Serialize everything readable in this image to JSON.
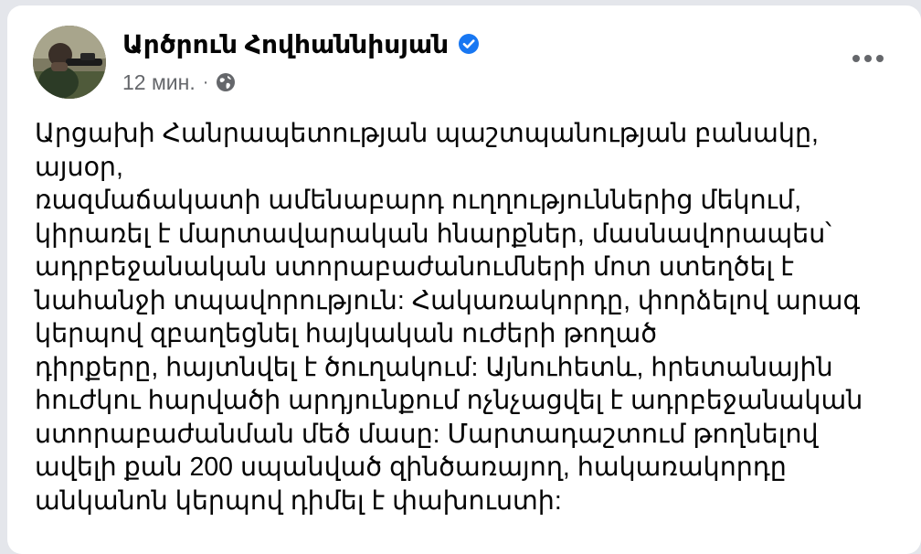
{
  "post": {
    "author": {
      "name": "Արծրուն Հովհաննիսյան",
      "verified_icon": "verified-badge-icon",
      "avatar": "profile-photo"
    },
    "meta": {
      "time": "12 мин.",
      "separator": "·",
      "audience_icon": "globe-icon"
    },
    "more_icon": "more-options-icon",
    "text_lines": [
      "Արցախի Հանրապետության պաշտպանության բանակը,",
      "այսօր,",
      "ռազմաճակատի ամենաբարդ ուղղություններից մեկում,",
      "կիրառել է մարտավարական հնարքներ, մասնավորապես՝",
      "ադրբեջանական ստորաբաժանումների մոտ ստեղծել է",
      "նահանջի տպավորություն: Հակառակորդը, փորձելով արագ",
      "կերպով զբաղեցնել հայկական ուժերի թողած",
      "դիրքերը, հայտնվել է ծուղակում: Այնուհետև, հրետանային",
      "հուժկու հարվածի արդյունքում ոչնչացվել է ադրբեջանական",
      "ստորաբաժանման մեծ մասը: Մարտադաշտում թողնելով",
      "ավելի քան 200 սպանված զինծառայող, հակառակորդը",
      "անկանոն կերպով դիմել է փախուստի:"
    ]
  },
  "colors": {
    "page_background": "#e4e6eb",
    "card_background": "#ffffff",
    "primary_text": "#050505",
    "secondary_text": "#65676b",
    "verified_blue": "#1877f2"
  }
}
